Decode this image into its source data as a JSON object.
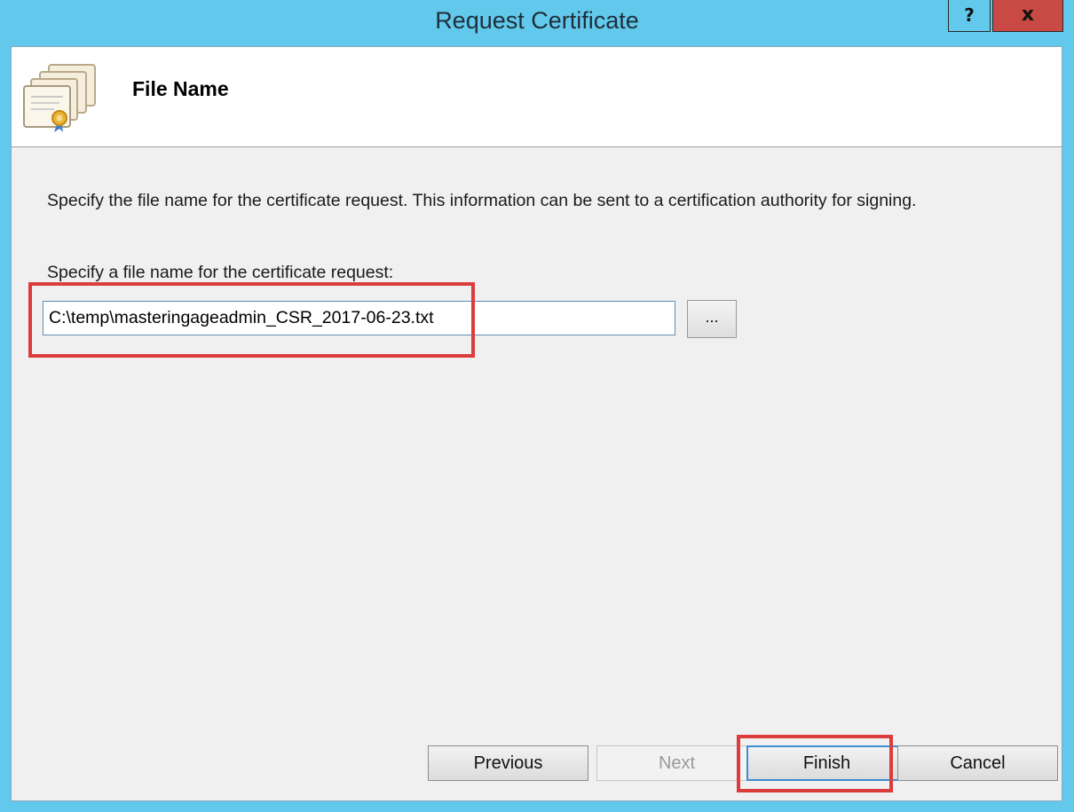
{
  "window": {
    "title": "Request Certificate",
    "help_label": "?",
    "close_label": "x"
  },
  "header": {
    "title": "File Name",
    "icon": "certificate-stack-icon"
  },
  "content": {
    "description": "Specify the file name for the certificate request. This information can be sent to a certification authority for signing.",
    "field_label": "Specify a file name for the certificate request:",
    "file_name_value": "C:\\temp\\masteringageadmin_CSR_2017-06-23.txt",
    "browse_label": "..."
  },
  "footer": {
    "previous_label": "Previous",
    "next_label": "Next",
    "finish_label": "Finish",
    "cancel_label": "Cancel"
  },
  "colors": {
    "frame": "#63c9ec",
    "close_button": "#c94a44",
    "highlight": "#dc3c3c"
  }
}
